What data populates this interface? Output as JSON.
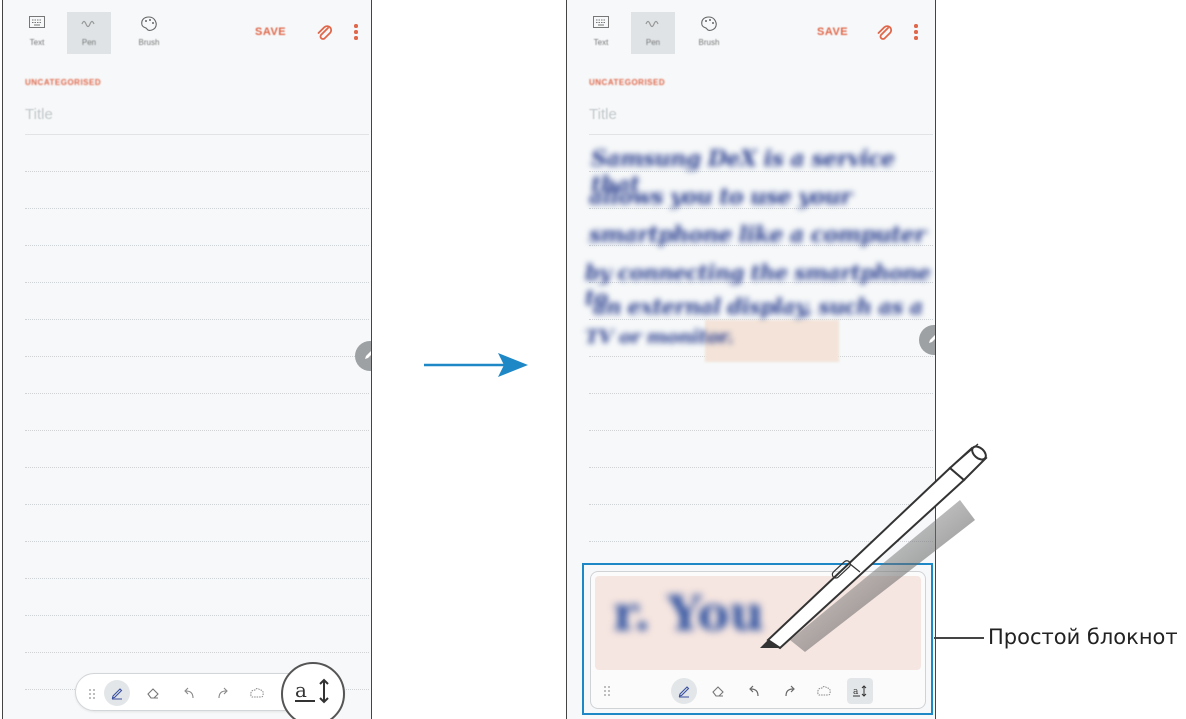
{
  "toolbar": {
    "modes": [
      {
        "label": "Text",
        "icon": "keyboard-icon"
      },
      {
        "label": "Pen",
        "icon": "handwriting-icon"
      },
      {
        "label": "Brush",
        "icon": "palette-icon"
      }
    ],
    "save_label": "SAVE",
    "icons": {
      "attach": "paperclip-icon",
      "more": "more-vertical-icon"
    }
  },
  "note": {
    "category": "UNCATEGORISED",
    "title_placeholder": "Title",
    "handwritten_lines": [
      "Samsung DeX is a service that",
      "allows you to use your",
      "smartphone like a computer",
      "by connecting the smartphone to",
      "an external display, such as a",
      "TV or monitor."
    ]
  },
  "pen_toolbar": {
    "tools": [
      "pen-icon",
      "eraser-icon",
      "undo-icon",
      "redo-icon",
      "lasso-icon",
      "simple-notepad-icon"
    ]
  },
  "simple_pad": {
    "written_text": "r. You"
  },
  "callout": {
    "label": "Простой блокнот"
  },
  "colors": {
    "accent": "#e0674a",
    "highlight_border": "#1e88c7",
    "arrow": "#1e88c7",
    "handwriting": "#2b3f8f"
  }
}
